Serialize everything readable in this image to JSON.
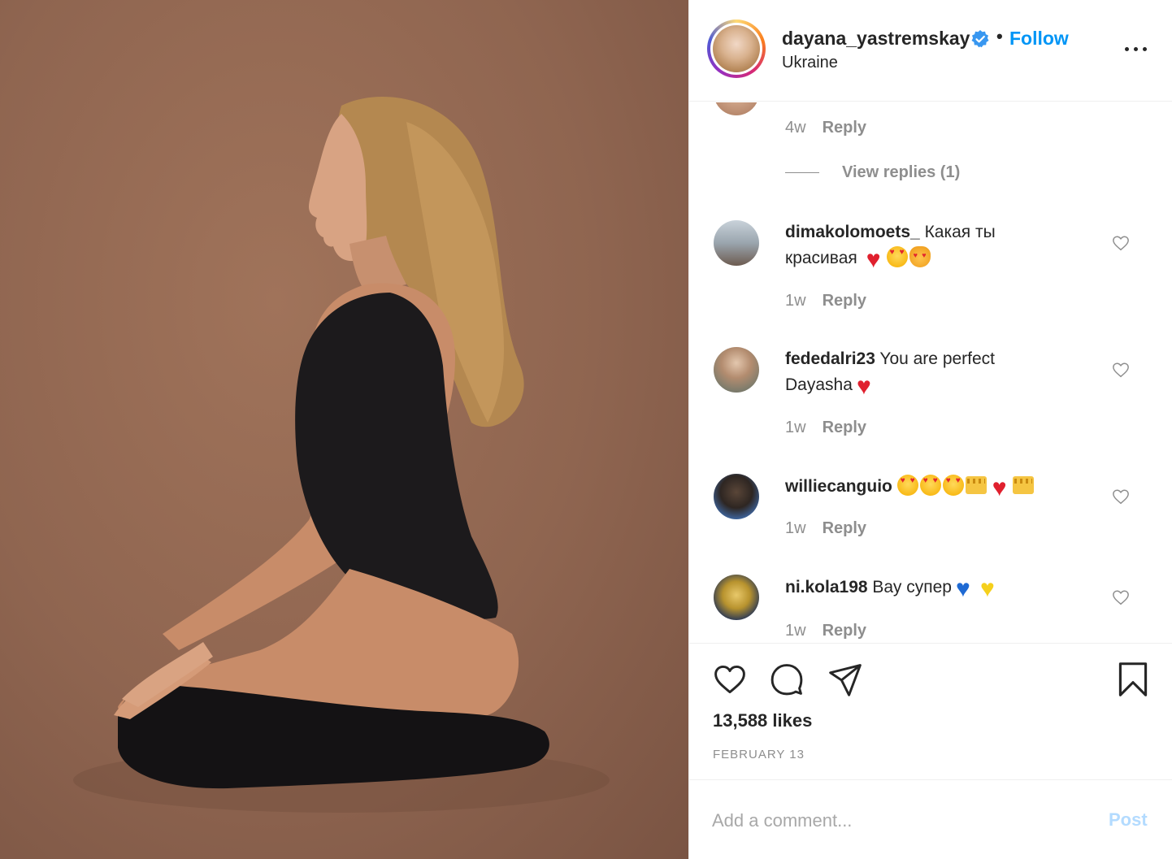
{
  "header": {
    "username": "dayana_yastremskay",
    "separator": "•",
    "follow_label": "Follow",
    "location": "Ukraine"
  },
  "comments_panel": {
    "first_meta": {
      "age": "4w",
      "reply_label": "Reply"
    },
    "view_replies_label": "View replies (1)",
    "items": [
      {
        "username": "dimakolomoets_",
        "text": "Какая ты красивая",
        "emojis": [
          "heart",
          "face",
          "cat"
        ],
        "age": "1w",
        "reply_label": "Reply"
      },
      {
        "username": "fededalri23",
        "text": "You are perfect Dayasha",
        "emojis": [
          "heart"
        ],
        "age": "1w",
        "reply_label": "Reply"
      },
      {
        "username": "williecanguio",
        "text": "",
        "emojis": [
          "face",
          "face",
          "face",
          "crown",
          "heart",
          "crown"
        ],
        "age": "1w",
        "reply_label": "Reply"
      },
      {
        "username": "ni.kola198",
        "text": "Вау супер",
        "emojis": [
          "blue-heart",
          "yellow-heart"
        ],
        "age": "1w",
        "reply_label": "Reply"
      }
    ]
  },
  "actions": {
    "likes": "13,588 likes",
    "date": "FEBRUARY 13"
  },
  "add_comment": {
    "placeholder": "Add a comment...",
    "post_label": "Post"
  },
  "colors": {
    "accent": "#0095f6",
    "post_disabled": "#b3dbff",
    "muted": "#8e8e8e",
    "photo_background": "#8f6550"
  }
}
